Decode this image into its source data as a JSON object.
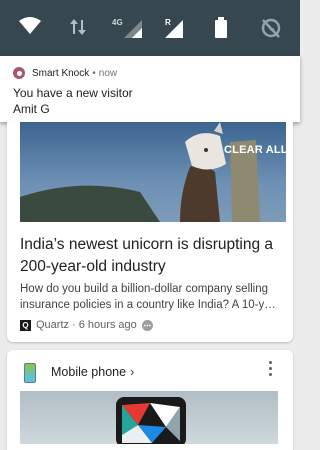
{
  "status_bar": {
    "icons": [
      "wifi-icon",
      "data-transfer-icon",
      "signal-4g-icon",
      "signal-roaming-icon",
      "battery-icon",
      "location-off-icon"
    ],
    "network_label": "4G",
    "roaming_label": "R"
  },
  "notification": {
    "app_name": "Smart Knock",
    "separator": "•",
    "time": "now",
    "title": "You have a new visitor",
    "text": "Amit G",
    "app_color": "#a8586e"
  },
  "clear_all_label": "CLEAR ALL",
  "news_card": {
    "headline": "India’s newest unicorn is disrupting a 200-year-old industry",
    "summary": "How do you build a billion-dollar company selling insurance policies in a country like India? A 10-y…",
    "source": "Quartz",
    "separator": "·",
    "time": "6 hours ago",
    "source_icon_letter": "Q"
  },
  "phone_card": {
    "title": "Mobile phone",
    "chevron": "›"
  }
}
